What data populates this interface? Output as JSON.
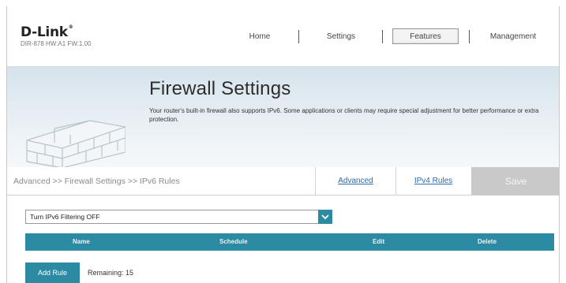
{
  "header": {
    "logo_text": "D-Link",
    "logo_mark": "®",
    "model_info": "DIR-878 HW:A1 FW:1.00",
    "nav": [
      {
        "label": "Home"
      },
      {
        "label": "Settings"
      },
      {
        "label": "Features"
      },
      {
        "label": "Management"
      }
    ],
    "active_nav": "Features"
  },
  "banner": {
    "title": "Firewall Settings",
    "description": "Your router's built-in firewall also supports IPv6. Some applications or clients may require special adjustment for better performance or extra protection.",
    "illustration": "brick-wall-icon"
  },
  "toolbar": {
    "breadcrumb": "Advanced >> Firewall Settings >> IPv6 Rules",
    "advanced_link": "Advanced",
    "ipv4_rules_link": "IPv4 Rules",
    "save_label": "Save"
  },
  "filter": {
    "selected": "Turn IPv6 Filtering OFF",
    "icon": "chevron-down-icon"
  },
  "table": {
    "columns": [
      "Name",
      "Schedule",
      "Edit",
      "Delete"
    ]
  },
  "rules": {
    "add_label": "Add Rule",
    "remaining_text": "Remaining: 15"
  },
  "colors": {
    "accent": "#2d8aa3",
    "save_disabled": "#c9c9c9",
    "link": "#2a6aa8"
  }
}
